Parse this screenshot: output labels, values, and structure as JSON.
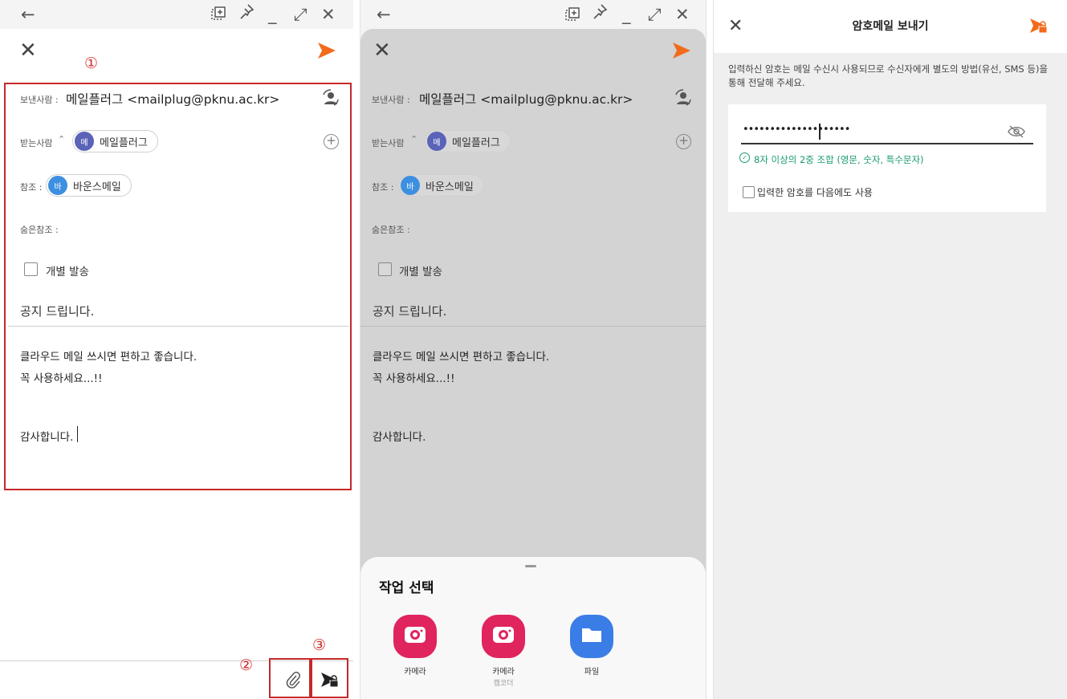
{
  "callouts": [
    "①",
    "②",
    "③"
  ],
  "compose": {
    "from_label": "보낸사람 :",
    "from_value": "메일플러그 <mailplug@pknu.ac.kr>",
    "to_label": "받는사람",
    "to_chip": {
      "avatar": "메",
      "name": "메일플러그",
      "color": "#5a63b8"
    },
    "cc_label": "참조 :",
    "cc_chip": {
      "avatar": "바",
      "name": "바운스메일",
      "color": "#3d8fe0"
    },
    "bcc_label": "숨은참조 :",
    "individual_send_label": "개별 발송",
    "subject": "공지 드립니다.",
    "body_lines": [
      "클라우드 메일 쓰시면 편하고 좋습니다.",
      "꼭 사용하세요...!!",
      "감사합니다."
    ]
  },
  "action_sheet": {
    "title": "작업 선택",
    "apps": [
      {
        "label": "카메라",
        "sub": "",
        "icon": "camera-icon",
        "color": "#e0245e"
      },
      {
        "label": "카메라",
        "sub": "캠코더",
        "icon": "camcorder-icon",
        "color": "#e0245e"
      },
      {
        "label": "파일",
        "sub": "",
        "icon": "folder-icon",
        "color": "#3b7de6"
      }
    ]
  },
  "password_mail": {
    "title": "암호메일 보내기",
    "notice": "입력하신 암호는 메일 수신시 사용되므로 수신자에게 별도의 방법(유선, SMS 등)을 통해 전달해 주세요.",
    "password_masked": "••••••••••••••••••••",
    "hint": "8자 이상의 2중 조합 (영문, 숫자, 특수문자)",
    "remember_label": "입력한 암호를 다음에도 사용"
  },
  "colors": {
    "accent": "#f26b1d",
    "callout": "#d32f2f",
    "hint": "#1a9c6b"
  }
}
